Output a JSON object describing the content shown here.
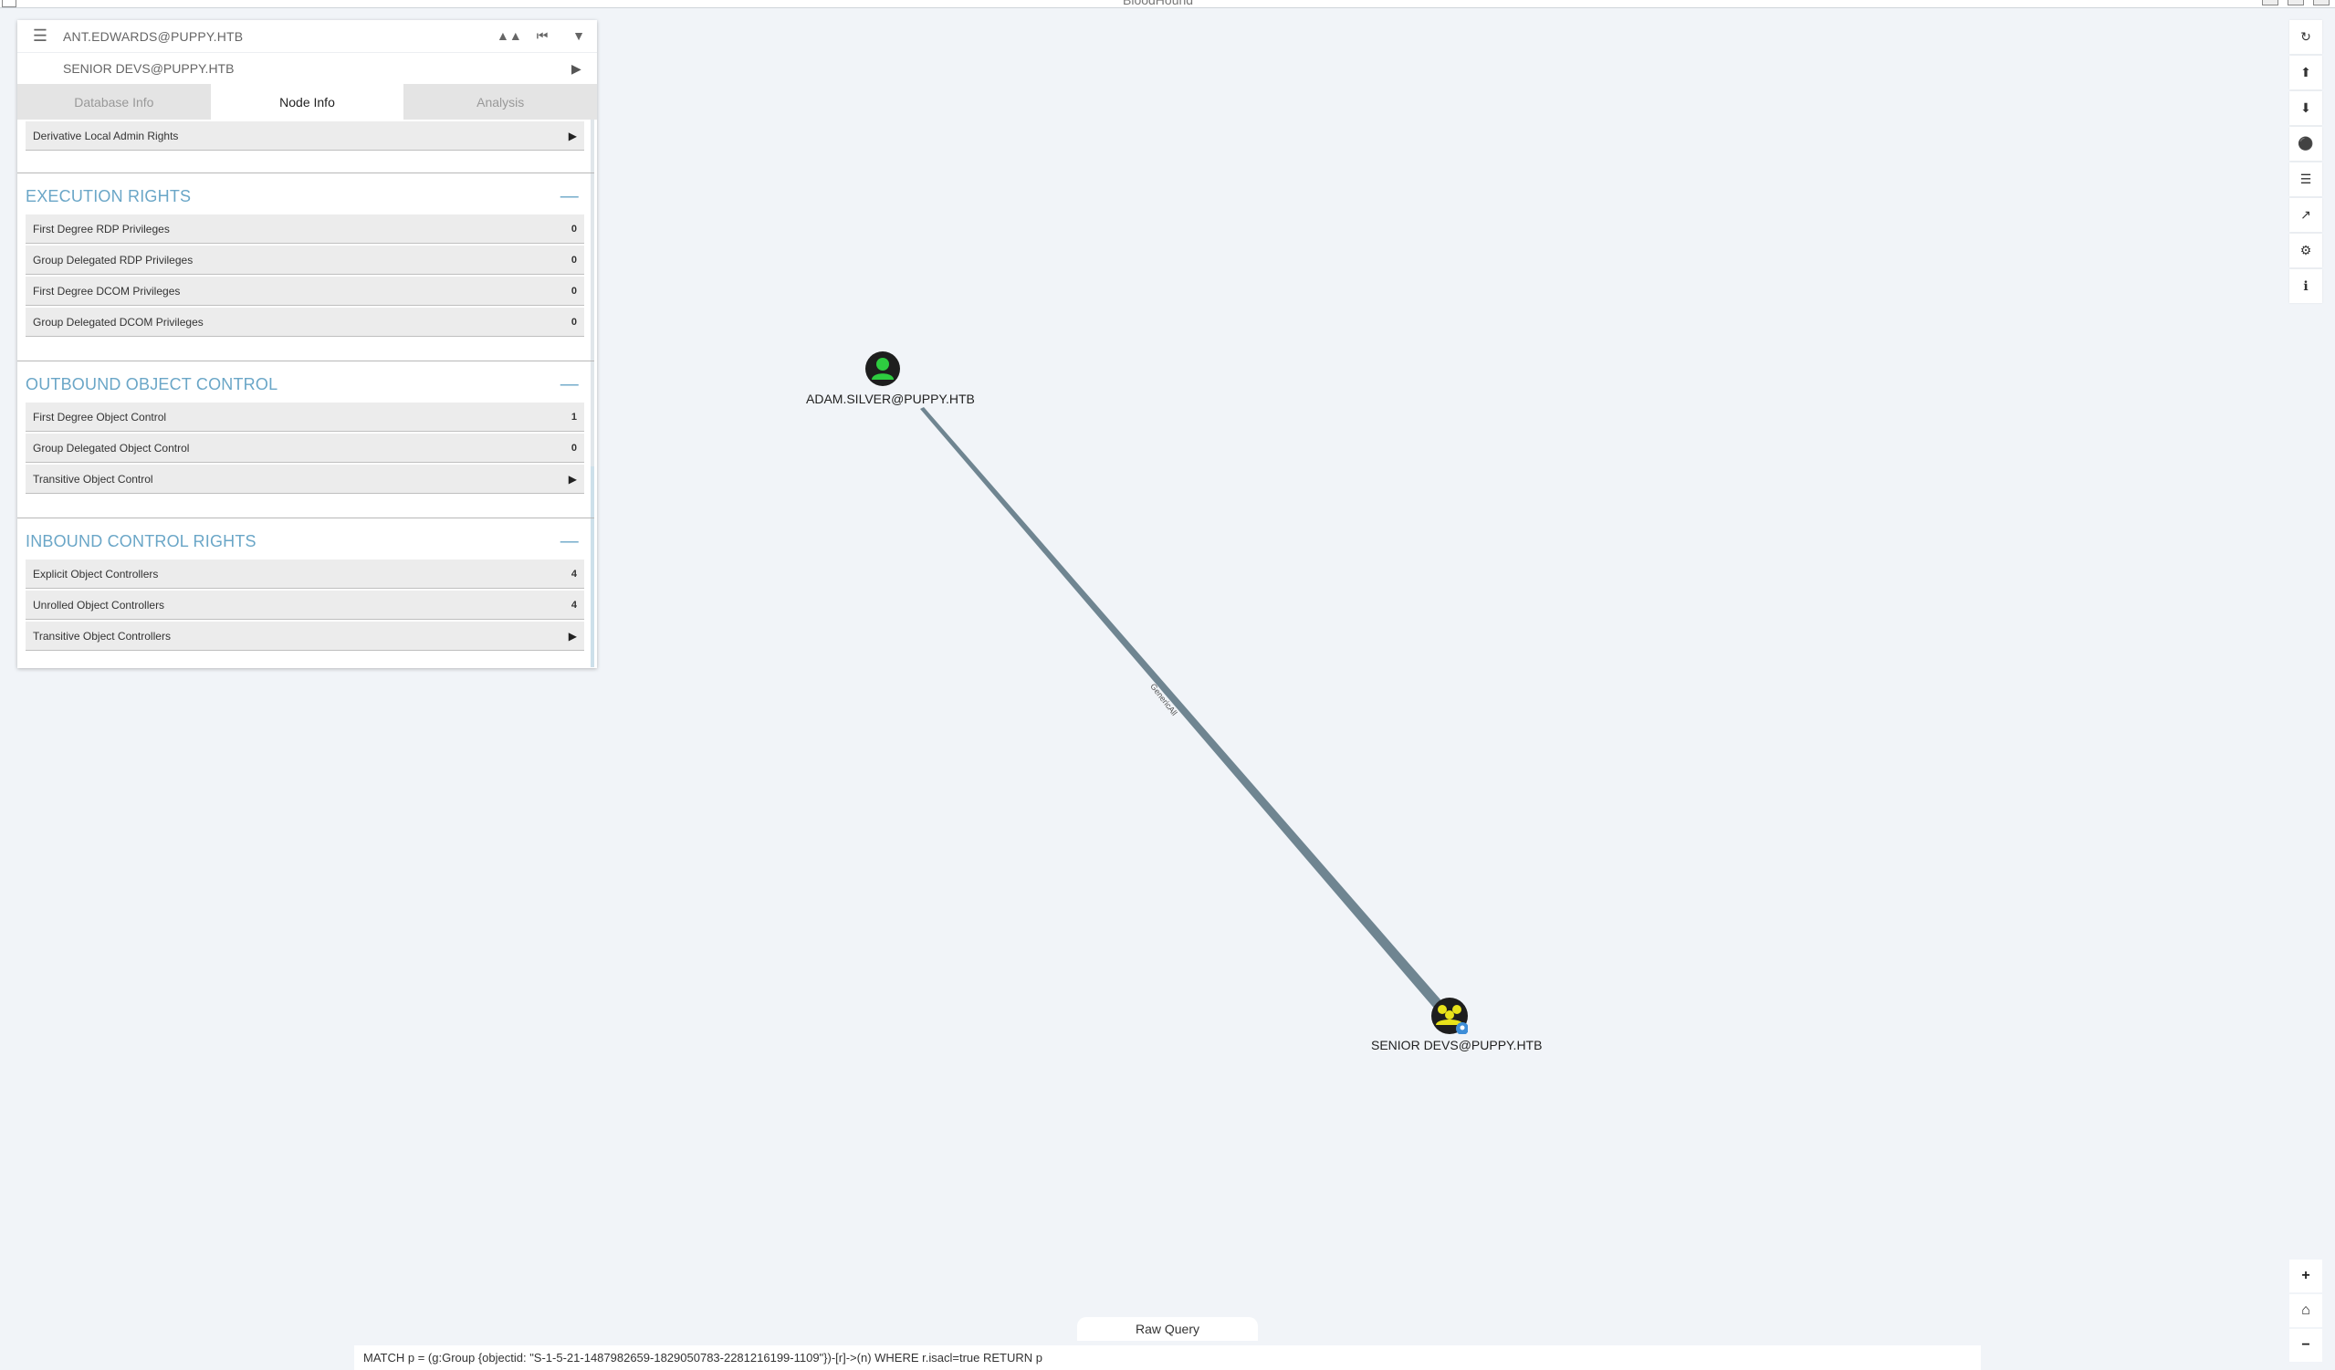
{
  "window": {
    "title": "BloodHound"
  },
  "search": {
    "start_node": "ANT.EDWARDS@PUPPY.HTB",
    "target_node": "SENIOR DEVS@PUPPY.HTB"
  },
  "tabs": [
    {
      "label": "Database Info",
      "active": false
    },
    {
      "label": "Node Info",
      "active": true
    },
    {
      "label": "Analysis",
      "active": false
    }
  ],
  "node_info": {
    "local_admin_partial_label": "Derivative Local Admin Rights",
    "execution_rights": {
      "title": "EXECUTION RIGHTS",
      "rows": [
        {
          "label": "First Degree RDP Privileges",
          "value": "0"
        },
        {
          "label": "Group Delegated RDP Privileges",
          "value": "0"
        },
        {
          "label": "First Degree DCOM Privileges",
          "value": "0"
        },
        {
          "label": "Group Delegated DCOM Privileges",
          "value": "0"
        }
      ]
    },
    "outbound_control": {
      "title": "OUTBOUND OBJECT CONTROL",
      "rows": [
        {
          "label": "First Degree Object Control",
          "value": "1"
        },
        {
          "label": "Group Delegated Object Control",
          "value": "0"
        },
        {
          "label": "Transitive Object Control",
          "value": ""
        }
      ]
    },
    "inbound_control": {
      "title": "INBOUND CONTROL RIGHTS",
      "rows": [
        {
          "label": "Explicit Object Controllers",
          "value": "4"
        },
        {
          "label": "Unrolled Object Controllers",
          "value": "4"
        },
        {
          "label": "Transitive Object Controllers",
          "value": ""
        }
      ]
    }
  },
  "graph": {
    "user_node": {
      "label": "ADAM.SILVER@PUPPY.HTB",
      "color": "#2ecc40"
    },
    "group_node": {
      "label": "SENIOR DEVS@PUPPY.HTB",
      "color": "#e8e21a"
    },
    "edge_label": "GenericAll"
  },
  "raw_query": {
    "tab_label": "Raw Query",
    "value": "MATCH p = (g:Group {objectid: \"S-1-5-21-1487982659-1829050783-2281216199-1109\"})-[r]->(n) WHERE r.isacl=true RETURN p"
  }
}
